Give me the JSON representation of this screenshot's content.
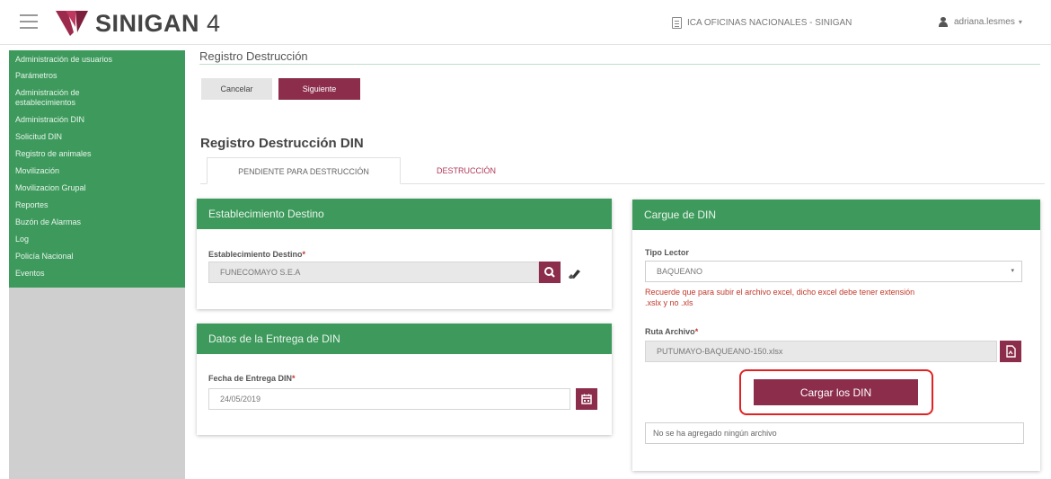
{
  "header": {
    "brand": "SINIGAN",
    "version": "4",
    "office": "ICA OFICINAS NACIONALES - SINIGAN",
    "user": "adriana.lesmes",
    "user_caret": "▾"
  },
  "sidebar": {
    "items": [
      {
        "label": "Administración de usuarios"
      },
      {
        "label": "Parámetros"
      },
      {
        "label": "Administración de establecimientos"
      },
      {
        "label": "Administración DIN"
      },
      {
        "label": "Solicitud DIN"
      },
      {
        "label": "Registro de animales"
      },
      {
        "label": "Movilización"
      },
      {
        "label": "Movilizacion Grupal"
      },
      {
        "label": "Reportes"
      },
      {
        "label": "Buzón de Alarmas"
      },
      {
        "label": "Log"
      },
      {
        "label": "Policía Nacional"
      },
      {
        "label": "Eventos"
      }
    ]
  },
  "page": {
    "title": "Registro Destrucción",
    "cancel_label": "Cancelar",
    "next_label": "Siguiente",
    "section_title": "Registro Destrucción DIN",
    "tabs": [
      {
        "label": "PENDIENTE PARA DESTRUCCIÓN",
        "active": true
      },
      {
        "label": "DESTRUCCIÓN",
        "active": false
      }
    ]
  },
  "establecimiento_panel": {
    "header": "Establecimiento Destino",
    "field_label": "Establecimiento Destino",
    "required_mark": "*",
    "value": "FUNECOMAYO S.E.A"
  },
  "entrega_panel": {
    "header": "Datos de la Entrega de DIN",
    "field_label": "Fecha de Entrega DIN",
    "required_mark": "*",
    "value": "24/05/2019"
  },
  "cargue_panel": {
    "header": "Cargue de DIN",
    "reader_label": "Tipo Lector",
    "reader_value": "BAQUEANO",
    "select_arrow": "▾",
    "warning_line1": "Recuerde que para subir el archivo excel, dicho excel debe tener extensión",
    "warning_line2": ".xslx y no .xls",
    "path_label": "Ruta Archivo",
    "required_mark": "*",
    "path_value": "PUTUMAYO-BAQUEANO-150.xlsx",
    "load_button": "Cargar los DIN",
    "status": "No se ha agregado ningún archivo"
  },
  "colors": {
    "green": "#3e9a5c",
    "maroon": "#8b2d4b",
    "highlight": "#e02222"
  }
}
